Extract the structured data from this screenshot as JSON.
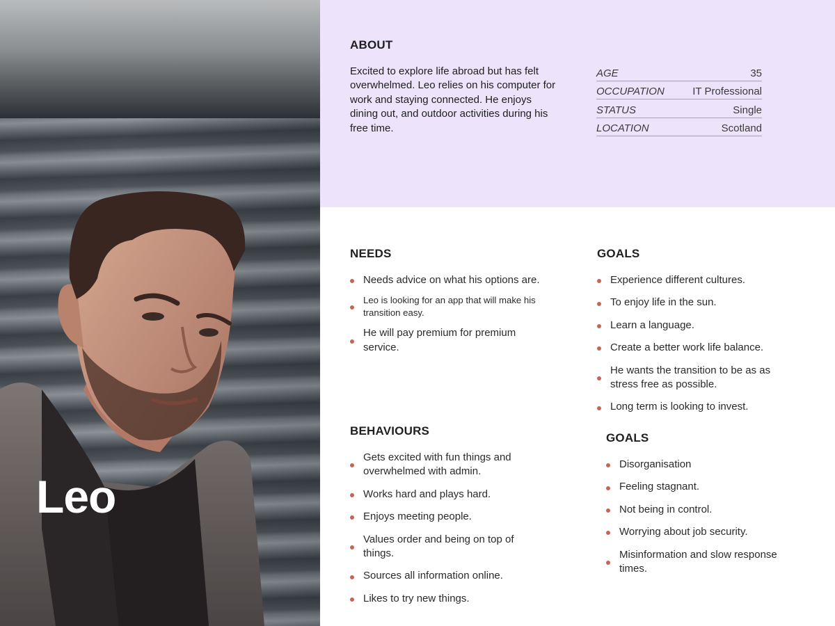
{
  "persona": {
    "name": "Leo"
  },
  "about": {
    "title": "ABOUT",
    "text": "Excited to explore life abroad but has felt overwhelmed. Leo relies on his computer for work and staying connected. He enjoys dining out, and outdoor activities during his free time.",
    "facts": [
      {
        "key": "AGE",
        "value": "35"
      },
      {
        "key": "OCCUPATION",
        "value": "IT Professional"
      },
      {
        "key": "STATUS",
        "value": "Single"
      },
      {
        "key": "LOCATION",
        "value": "Scotland"
      }
    ]
  },
  "needs": {
    "title": "NEEDS",
    "items": [
      "Needs advice on what his options are.",
      "Leo is looking for an app that will make his transition easy.",
      "He will pay premium for premium service."
    ]
  },
  "behaviours": {
    "title": "BEHAVIOURS",
    "items": [
      "Gets excited with fun things and overwhelmed with admin.",
      "Works hard and plays hard.",
      "Enjoys meeting people.",
      "Values order and being on top of things.",
      "Sources all information online.",
      "Likes to try new things."
    ]
  },
  "goals": {
    "title": "GOALS",
    "items": [
      "Experience different cultures.",
      "To enjoy life in the sun.",
      "Learn a language.",
      "Create a better work life balance.",
      "He wants the transition to be as as stress free as possible.",
      "Long term is looking to invest."
    ]
  },
  "pain_points": {
    "title": "GOALS",
    "items": [
      "Disorganisation",
      "Feeling stagnant.",
      "Not being in control.",
      "Worrying about job security.",
      "Misinformation and slow response times."
    ]
  },
  "colors": {
    "accent_band": "#ede3fb",
    "bullet": "#c4655c"
  }
}
